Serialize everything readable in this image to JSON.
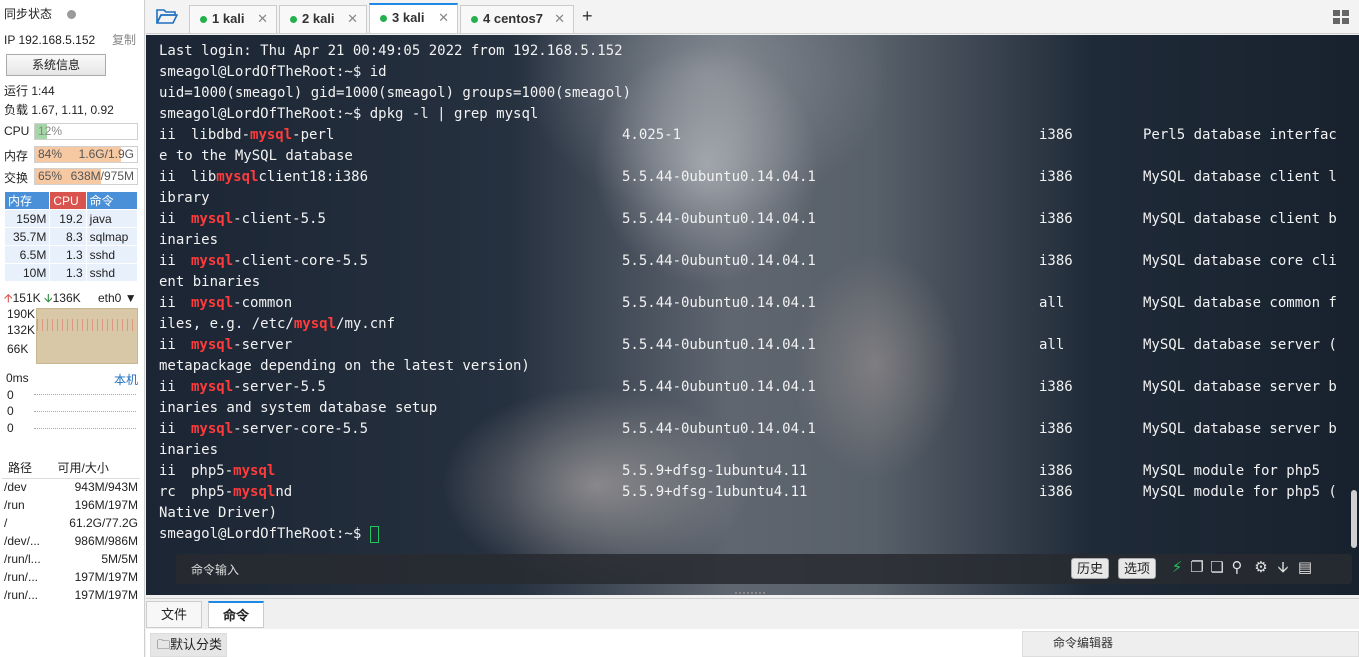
{
  "sidebar": {
    "sync_label": "同步状态",
    "ip": "IP 192.168.5.152",
    "copy": "复制",
    "sysinfo": "系统信息",
    "uptime": "运行 1:44",
    "load": "负载 1.67, 1.11, 0.92",
    "cpu": {
      "label": "CPU",
      "text": "12%",
      "level": 0.12
    },
    "mem": {
      "label": "内存",
      "pct": "84%",
      "detail": "1.6G/1.9G",
      "level": 0.84
    },
    "swap": {
      "label": "交换",
      "pct": "65%",
      "detail": "638M/975M",
      "level": 0.65
    },
    "proc_headers": [
      "内存",
      "CPU",
      "命令"
    ],
    "procs": [
      {
        "mem": "159M",
        "cpu": "19.2",
        "cmd": "java"
      },
      {
        "mem": "35.7M",
        "cpu": "8.3",
        "cmd": "sqlmap"
      },
      {
        "mem": "6.5M",
        "cpu": "1.3",
        "cmd": "sshd"
      },
      {
        "mem": "10M",
        "cpu": "1.3",
        "cmd": "sshd"
      }
    ],
    "net": {
      "up": "151K",
      "down": "136K",
      "iface": "eth0",
      "ticks": [
        "190K",
        "132K",
        "66K"
      ]
    },
    "latency": {
      "label": "0ms",
      "host": "本机",
      "values": [
        "0",
        "0",
        "0"
      ]
    },
    "disk_headers": [
      "路径",
      "可用/大小"
    ],
    "disks": [
      {
        "path": "/dev",
        "size": "943M/943M"
      },
      {
        "path": "/run",
        "size": "196M/197M"
      },
      {
        "path": "/",
        "size": "61.2G/77.2G"
      },
      {
        "path": "/dev/...",
        "size": "986M/986M"
      },
      {
        "path": "/run/l...",
        "size": "5M/5M"
      },
      {
        "path": "/run/...",
        "size": "197M/197M"
      },
      {
        "path": "/run/...",
        "size": "197M/197M"
      }
    ]
  },
  "tabs": [
    {
      "label": "1 kali",
      "active": false
    },
    {
      "label": "2 kali",
      "active": false
    },
    {
      "label": "3 kali",
      "active": true
    },
    {
      "label": "4 centos7",
      "active": false
    }
  ],
  "terminal": {
    "login": "Last login: Thu Apr 21 00:49:05 2022 from 192.168.5.152",
    "prompt": "smeagol@LordOfTheRoot:~$",
    "cmd1": " id",
    "id_output": "uid=1000(smeagol) gid=1000(smeagol) groups=1000(smeagol)",
    "cmd2": " dpkg -l | grep mysql",
    "packages": [
      {
        "st": "ii",
        "pre": "libdbd-",
        "hl": "mysql",
        "post": "-perl",
        "ver": "4.025-1",
        "arch": "i386",
        "desc": "Perl5 database interfac",
        "wrap": "e to the MySQL database",
        "wrap_hl": []
      },
      {
        "st": "ii",
        "pre": "lib",
        "hl": "mysql",
        "post": "client18:i386",
        "ver": "5.5.44-0ubuntu0.14.04.1",
        "arch": "i386",
        "desc": "MySQL database client l",
        "wrap": "ibrary",
        "wrap_hl": []
      },
      {
        "st": "ii",
        "pre": "",
        "hl": "mysql",
        "post": "-client-5.5",
        "ver": "5.5.44-0ubuntu0.14.04.1",
        "arch": "i386",
        "desc": "MySQL database client b",
        "wrap": "inaries",
        "wrap_hl": []
      },
      {
        "st": "ii",
        "pre": "",
        "hl": "mysql",
        "post": "-client-core-5.5",
        "ver": "5.5.44-0ubuntu0.14.04.1",
        "arch": "i386",
        "desc": "MySQL database core cli",
        "wrap": "ent binaries",
        "wrap_hl": []
      },
      {
        "st": "ii",
        "pre": "",
        "hl": "mysql",
        "post": "-common",
        "ver": "5.5.44-0ubuntu0.14.04.1",
        "arch": "all",
        "desc": "MySQL database common f",
        "wrap": "iles, e.g. /etc/|mysql|/my.cnf",
        "wrap_hl": [
          1
        ]
      },
      {
        "st": "ii",
        "pre": "",
        "hl": "mysql",
        "post": "-server",
        "ver": "5.5.44-0ubuntu0.14.04.1",
        "arch": "all",
        "desc": "MySQL database server (",
        "wrap": "metapackage depending on the latest version)",
        "wrap_hl": []
      },
      {
        "st": "ii",
        "pre": "",
        "hl": "mysql",
        "post": "-server-5.5",
        "ver": "5.5.44-0ubuntu0.14.04.1",
        "arch": "i386",
        "desc": "MySQL database server b",
        "wrap": "inaries and system database setup",
        "wrap_hl": []
      },
      {
        "st": "ii",
        "pre": "",
        "hl": "mysql",
        "post": "-server-core-5.5",
        "ver": "5.5.44-0ubuntu0.14.04.1",
        "arch": "i386",
        "desc": "MySQL database server b",
        "wrap": "inaries",
        "wrap_hl": []
      },
      {
        "st": "ii",
        "pre": "php5-",
        "hl": "mysql",
        "post": "",
        "ver": "5.5.9+dfsg-1ubuntu4.11",
        "arch": "i386",
        "desc": "MySQL module for php5",
        "wrap": "",
        "wrap_hl": []
      },
      {
        "st": "rc",
        "pre": "php5-",
        "hl": "mysql",
        "post": "nd",
        "ver": "5.5.9+dfsg-1ubuntu4.11",
        "arch": "i386",
        "desc": "MySQL module for php5 (",
        "wrap": "Native Driver)",
        "wrap_hl": []
      }
    ],
    "colors": {
      "highlight": "#ff3b3b",
      "cursor": "#22c55e"
    }
  },
  "command_bar": {
    "placeholder": "命令输入",
    "history": "历史",
    "options": "选项",
    "icons": [
      "lightning-icon",
      "copy-icon",
      "paste-icon",
      "search-icon",
      "gear-icon",
      "download-icon",
      "window-icon"
    ]
  },
  "bottom": {
    "tabs": [
      "文件",
      "命令"
    ],
    "active_tab": "命令",
    "category": "默认分类",
    "editor": "命令编辑器"
  }
}
